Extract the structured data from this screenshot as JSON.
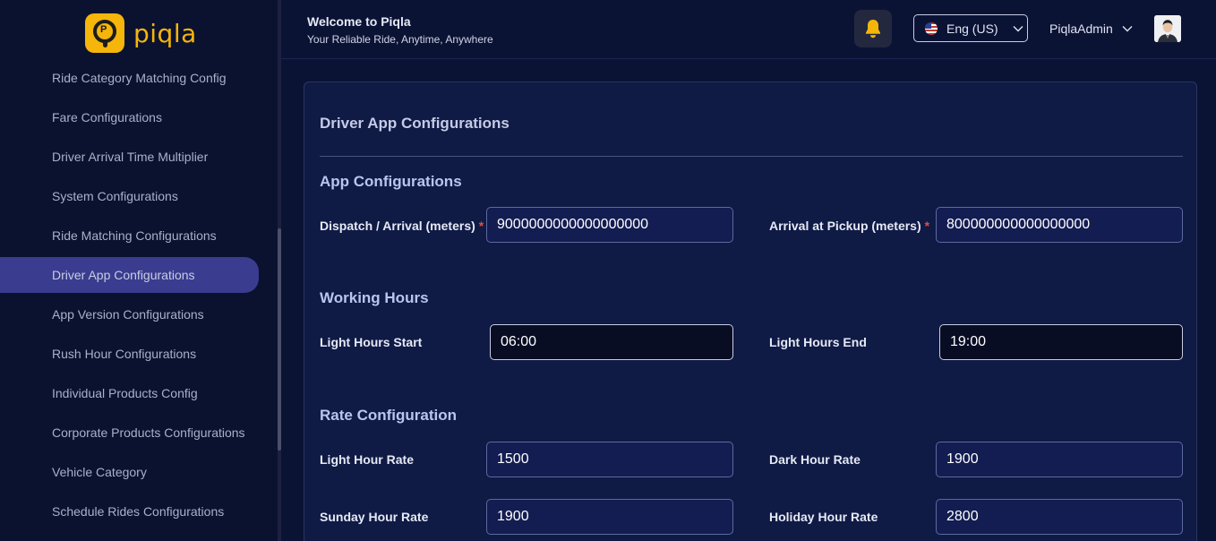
{
  "brand": {
    "name": "piqla",
    "badge_letter": "P",
    "accent": "#f5b50a"
  },
  "sidebar": {
    "items": [
      {
        "label": "Ride Category Matching Config",
        "active": false
      },
      {
        "label": "Fare Configurations",
        "active": false
      },
      {
        "label": "Driver Arrival Time Multiplier",
        "active": false
      },
      {
        "label": "System Configurations",
        "active": false
      },
      {
        "label": "Ride Matching Configurations",
        "active": false
      },
      {
        "label": "Driver App Configurations",
        "active": true
      },
      {
        "label": "App Version Configurations",
        "active": false
      },
      {
        "label": "Rush Hour Configurations",
        "active": false
      },
      {
        "label": "Individual Products Config",
        "active": false
      },
      {
        "label": "Corporate Products Configurations",
        "active": false
      },
      {
        "label": "Vehicle Category",
        "active": false
      },
      {
        "label": "Schedule Rides Configurations",
        "active": false
      }
    ]
  },
  "header": {
    "welcome": "Welcome to Piqla",
    "tagline": "Your Reliable Ride, Anytime, Anywhere",
    "language": "Eng (US)",
    "user": "PiqlaAdmin"
  },
  "main": {
    "title": "Driver App Configurations",
    "app_configurations": {
      "title": "App Configurations",
      "dispatch_label": "Dispatch / Arrival (meters)",
      "dispatch_value": "9000000000000000000",
      "pickup_label": "Arrival at Pickup (meters)",
      "pickup_value": "800000000000000000",
      "required_mark": "*"
    },
    "working_hours": {
      "title": "Working Hours",
      "start_label": "Light Hours Start",
      "start_value": "06:00",
      "end_label": "Light Hours End",
      "end_value": "19:00"
    },
    "rate_configuration": {
      "title": "Rate Configuration",
      "light_label": "Light Hour Rate",
      "light_value": "1500",
      "dark_label": "Dark Hour Rate",
      "dark_value": "1900",
      "sunday_label": "Sunday Hour Rate",
      "sunday_value": "1900",
      "holiday_label": "Holiday Hour Rate",
      "holiday_value": "2800"
    }
  }
}
